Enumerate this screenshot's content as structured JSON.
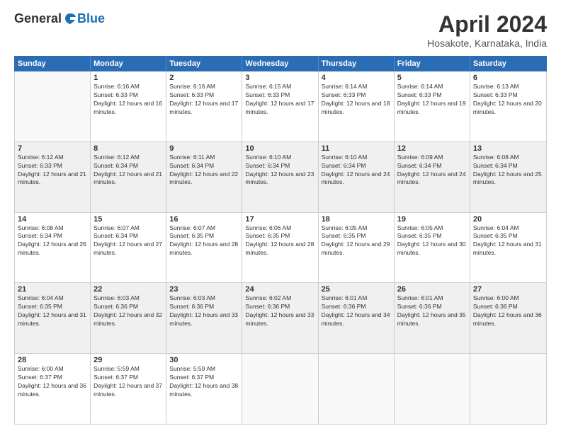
{
  "logo": {
    "general": "General",
    "blue": "Blue"
  },
  "title": "April 2024",
  "subtitle": "Hosakote, Karnataka, India",
  "days": [
    "Sunday",
    "Monday",
    "Tuesday",
    "Wednesday",
    "Thursday",
    "Friday",
    "Saturday"
  ],
  "weeks": [
    {
      "shaded": false,
      "cells": [
        {
          "day": "",
          "empty": true
        },
        {
          "day": "1",
          "sunrise": "Sunrise: 6:16 AM",
          "sunset": "Sunset: 6:33 PM",
          "daylight": "Daylight: 12 hours and 16 minutes."
        },
        {
          "day": "2",
          "sunrise": "Sunrise: 6:16 AM",
          "sunset": "Sunset: 6:33 PM",
          "daylight": "Daylight: 12 hours and 17 minutes."
        },
        {
          "day": "3",
          "sunrise": "Sunrise: 6:15 AM",
          "sunset": "Sunset: 6:33 PM",
          "daylight": "Daylight: 12 hours and 17 minutes."
        },
        {
          "day": "4",
          "sunrise": "Sunrise: 6:14 AM",
          "sunset": "Sunset: 6:33 PM",
          "daylight": "Daylight: 12 hours and 18 minutes."
        },
        {
          "day": "5",
          "sunrise": "Sunrise: 6:14 AM",
          "sunset": "Sunset: 6:33 PM",
          "daylight": "Daylight: 12 hours and 19 minutes."
        },
        {
          "day": "6",
          "sunrise": "Sunrise: 6:13 AM",
          "sunset": "Sunset: 6:33 PM",
          "daylight": "Daylight: 12 hours and 20 minutes."
        }
      ]
    },
    {
      "shaded": true,
      "cells": [
        {
          "day": "7",
          "sunrise": "Sunrise: 6:12 AM",
          "sunset": "Sunset: 6:33 PM",
          "daylight": "Daylight: 12 hours and 21 minutes."
        },
        {
          "day": "8",
          "sunrise": "Sunrise: 6:12 AM",
          "sunset": "Sunset: 6:34 PM",
          "daylight": "Daylight: 12 hours and 21 minutes."
        },
        {
          "day": "9",
          "sunrise": "Sunrise: 6:11 AM",
          "sunset": "Sunset: 6:34 PM",
          "daylight": "Daylight: 12 hours and 22 minutes."
        },
        {
          "day": "10",
          "sunrise": "Sunrise: 6:10 AM",
          "sunset": "Sunset: 6:34 PM",
          "daylight": "Daylight: 12 hours and 23 minutes."
        },
        {
          "day": "11",
          "sunrise": "Sunrise: 6:10 AM",
          "sunset": "Sunset: 6:34 PM",
          "daylight": "Daylight: 12 hours and 24 minutes."
        },
        {
          "day": "12",
          "sunrise": "Sunrise: 6:09 AM",
          "sunset": "Sunset: 6:34 PM",
          "daylight": "Daylight: 12 hours and 24 minutes."
        },
        {
          "day": "13",
          "sunrise": "Sunrise: 6:08 AM",
          "sunset": "Sunset: 6:34 PM",
          "daylight": "Daylight: 12 hours and 25 minutes."
        }
      ]
    },
    {
      "shaded": false,
      "cells": [
        {
          "day": "14",
          "sunrise": "Sunrise: 6:08 AM",
          "sunset": "Sunset: 6:34 PM",
          "daylight": "Daylight: 12 hours and 26 minutes."
        },
        {
          "day": "15",
          "sunrise": "Sunrise: 6:07 AM",
          "sunset": "Sunset: 6:34 PM",
          "daylight": "Daylight: 12 hours and 27 minutes."
        },
        {
          "day": "16",
          "sunrise": "Sunrise: 6:07 AM",
          "sunset": "Sunset: 6:35 PM",
          "daylight": "Daylight: 12 hours and 28 minutes."
        },
        {
          "day": "17",
          "sunrise": "Sunrise: 6:06 AM",
          "sunset": "Sunset: 6:35 PM",
          "daylight": "Daylight: 12 hours and 28 minutes."
        },
        {
          "day": "18",
          "sunrise": "Sunrise: 6:05 AM",
          "sunset": "Sunset: 6:35 PM",
          "daylight": "Daylight: 12 hours and 29 minutes."
        },
        {
          "day": "19",
          "sunrise": "Sunrise: 6:05 AM",
          "sunset": "Sunset: 6:35 PM",
          "daylight": "Daylight: 12 hours and 30 minutes."
        },
        {
          "day": "20",
          "sunrise": "Sunrise: 6:04 AM",
          "sunset": "Sunset: 6:35 PM",
          "daylight": "Daylight: 12 hours and 31 minutes."
        }
      ]
    },
    {
      "shaded": true,
      "cells": [
        {
          "day": "21",
          "sunrise": "Sunrise: 6:04 AM",
          "sunset": "Sunset: 6:35 PM",
          "daylight": "Daylight: 12 hours and 31 minutes."
        },
        {
          "day": "22",
          "sunrise": "Sunrise: 6:03 AM",
          "sunset": "Sunset: 6:36 PM",
          "daylight": "Daylight: 12 hours and 32 minutes."
        },
        {
          "day": "23",
          "sunrise": "Sunrise: 6:03 AM",
          "sunset": "Sunset: 6:36 PM",
          "daylight": "Daylight: 12 hours and 33 minutes."
        },
        {
          "day": "24",
          "sunrise": "Sunrise: 6:02 AM",
          "sunset": "Sunset: 6:36 PM",
          "daylight": "Daylight: 12 hours and 33 minutes."
        },
        {
          "day": "25",
          "sunrise": "Sunrise: 6:01 AM",
          "sunset": "Sunset: 6:36 PM",
          "daylight": "Daylight: 12 hours and 34 minutes."
        },
        {
          "day": "26",
          "sunrise": "Sunrise: 6:01 AM",
          "sunset": "Sunset: 6:36 PM",
          "daylight": "Daylight: 12 hours and 35 minutes."
        },
        {
          "day": "27",
          "sunrise": "Sunrise: 6:00 AM",
          "sunset": "Sunset: 6:36 PM",
          "daylight": "Daylight: 12 hours and 36 minutes."
        }
      ]
    },
    {
      "shaded": false,
      "cells": [
        {
          "day": "28",
          "sunrise": "Sunrise: 6:00 AM",
          "sunset": "Sunset: 6:37 PM",
          "daylight": "Daylight: 12 hours and 36 minutes."
        },
        {
          "day": "29",
          "sunrise": "Sunrise: 5:59 AM",
          "sunset": "Sunset: 6:37 PM",
          "daylight": "Daylight: 12 hours and 37 minutes."
        },
        {
          "day": "30",
          "sunrise": "Sunrise: 5:59 AM",
          "sunset": "Sunset: 6:37 PM",
          "daylight": "Daylight: 12 hours and 38 minutes."
        },
        {
          "day": "",
          "empty": true
        },
        {
          "day": "",
          "empty": true
        },
        {
          "day": "",
          "empty": true
        },
        {
          "day": "",
          "empty": true
        }
      ]
    }
  ]
}
